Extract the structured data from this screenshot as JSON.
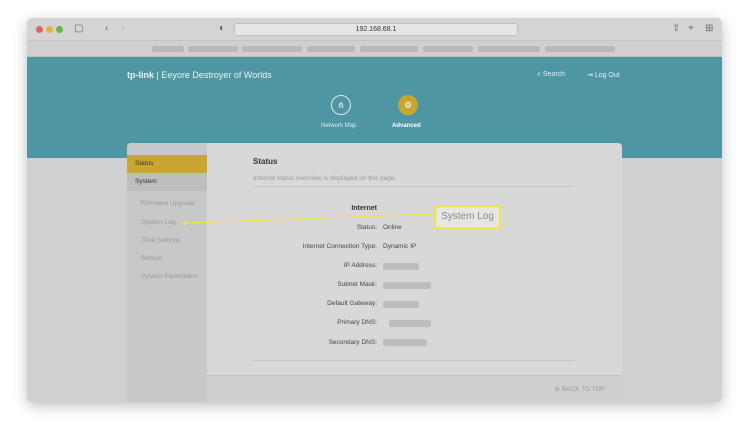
{
  "browser": {
    "url": "192.168.68.1"
  },
  "header": {
    "brand": "tp-link",
    "router_name": "Eeyore Destroyer of Worlds",
    "search": "Search",
    "logout": "Log Out",
    "nav": [
      {
        "label": "Network Map"
      },
      {
        "label": "Advanced"
      }
    ]
  },
  "sidebar": {
    "items": [
      {
        "label": "Status"
      },
      {
        "label": "System"
      }
    ],
    "subitems": [
      {
        "label": "Firmware Upgrade"
      },
      {
        "label": "System Log"
      },
      {
        "label": "Time Settings"
      },
      {
        "label": "Reboot"
      },
      {
        "label": "System Parameters"
      }
    ]
  },
  "main": {
    "title": "Status",
    "subtitle": "Internet status overview is displayed on this page.",
    "section": "Internet",
    "rows": [
      {
        "label": "Status:",
        "value": "Online"
      },
      {
        "label": "Internet Connection Type:",
        "value": "Dynamic IP"
      },
      {
        "label": "IP Address:"
      },
      {
        "label": "Subnet Mask:"
      },
      {
        "label": "Default Gateway:"
      },
      {
        "label": "Primary DNS:"
      },
      {
        "label": "Secondary DNS:"
      }
    ],
    "back_to_top": "BACK TO TOP"
  },
  "annotation": {
    "label": "System Log",
    "color": "#f1e44b"
  },
  "colors": {
    "header": "#4f96a4",
    "accent": "#c9a531"
  }
}
